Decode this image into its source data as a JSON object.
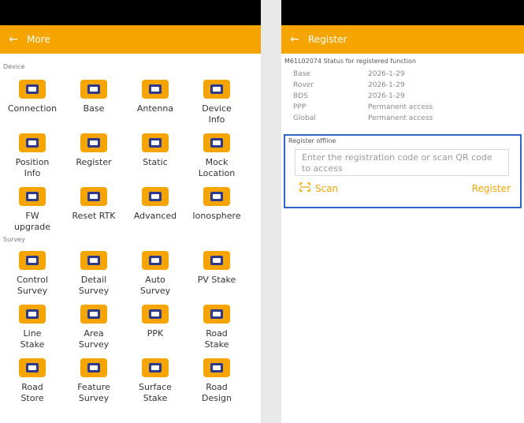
{
  "left": {
    "title": "More",
    "device_label": "Device",
    "survey_label": "Survey",
    "device_items": [
      {
        "label": "Connection",
        "icon": "connection-icon"
      },
      {
        "label": "Base",
        "icon": "base-icon"
      },
      {
        "label": "Antenna",
        "icon": "antenna-icon"
      },
      {
        "label": "Device\nInfo",
        "icon": "device-info-icon"
      },
      {
        "label": "Position\nInfo",
        "icon": "position-info-icon"
      },
      {
        "label": "Register",
        "icon": "register-icon"
      },
      {
        "label": "Static",
        "icon": "static-icon"
      },
      {
        "label": "Mock\nLocation",
        "icon": "mock-location-icon"
      },
      {
        "label": "FW\nupgrade",
        "icon": "firmware-upgrade-icon"
      },
      {
        "label": "Reset RTK",
        "icon": "reset-rtk-icon"
      },
      {
        "label": "Advanced",
        "icon": "advanced-settings-icon"
      },
      {
        "label": "Ionosphere",
        "icon": "ionosphere-icon"
      }
    ],
    "survey_items": [
      {
        "label": "Control\nSurvey",
        "icon": "control-survey-icon"
      },
      {
        "label": "Detail\nSurvey",
        "icon": "detail-survey-icon"
      },
      {
        "label": "Auto\nSurvey",
        "icon": "auto-survey-icon"
      },
      {
        "label": "PV Stake",
        "icon": "pv-stake-icon"
      },
      {
        "label": "Line\nStake",
        "icon": "line-stake-icon"
      },
      {
        "label": "Area\nSurvey",
        "icon": "area-survey-icon"
      },
      {
        "label": "PPK",
        "icon": "ppk-icon"
      },
      {
        "label": "Road\nStake",
        "icon": "road-stake-icon"
      },
      {
        "label": "Road\nStore",
        "icon": "road-store-icon"
      },
      {
        "label": "Feature\nSurvey",
        "icon": "feature-survey-icon"
      },
      {
        "label": "Surface\nStake",
        "icon": "surface-stake-icon"
      },
      {
        "label": "Road\nDesign",
        "icon": "road-design-icon"
      }
    ]
  },
  "right": {
    "title": "Register",
    "status_header": "M61L02074 Status for registered function",
    "rows": [
      {
        "k": "Base",
        "v": "2026-1-29"
      },
      {
        "k": "Rover",
        "v": "2026-1-29"
      },
      {
        "k": "BDS",
        "v": "2026-1-29"
      },
      {
        "k": "PPP",
        "v": "Permanent access"
      },
      {
        "k": "Global",
        "v": "Permanent access"
      }
    ],
    "offline_label": "Register offline",
    "input_placeholder": "Enter the registration code or scan QR code to access",
    "scan_label": "Scan",
    "register_label": "Register"
  },
  "colors": {
    "accent": "#f5a400",
    "highlight": "#2f66c8"
  }
}
